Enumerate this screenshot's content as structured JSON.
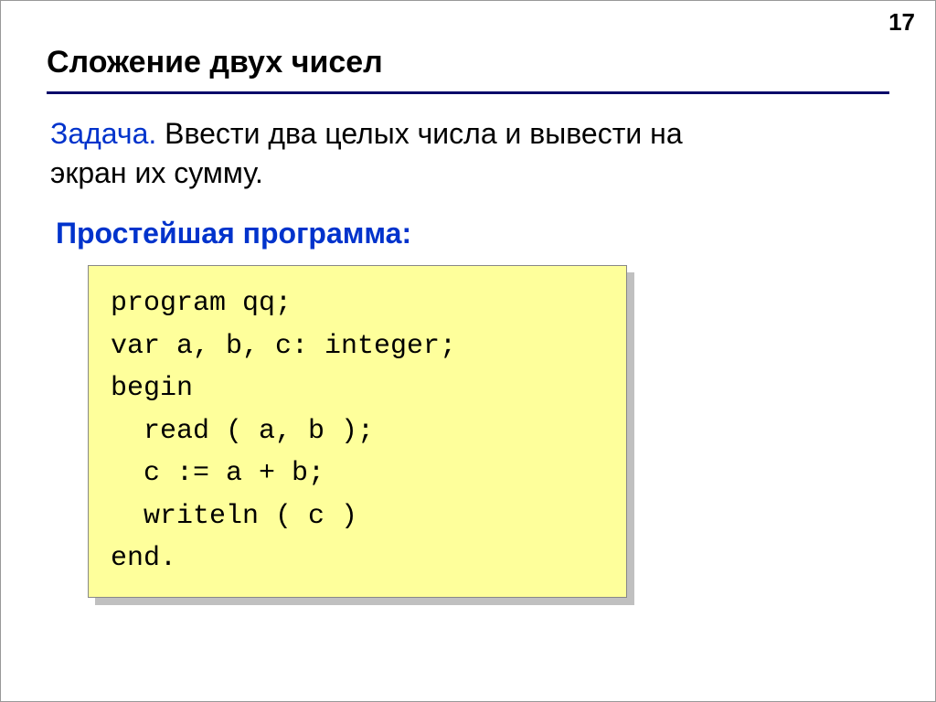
{
  "page_number": "17",
  "title": "Сложение двух чисел",
  "task": {
    "label": "Задача.",
    "text_line1": " Ввести два целых числа и вывести на",
    "text_line2": "экран их сумму."
  },
  "subheading": "Простейшая программа:",
  "code": {
    "l1": "program qq;",
    "l2": "var a, b, c: integer;",
    "l3": "begin",
    "l4": "  read ( a, b );",
    "l5": "  c := a + b;",
    "l6": "  writeln ( c )",
    "l7": "end."
  }
}
